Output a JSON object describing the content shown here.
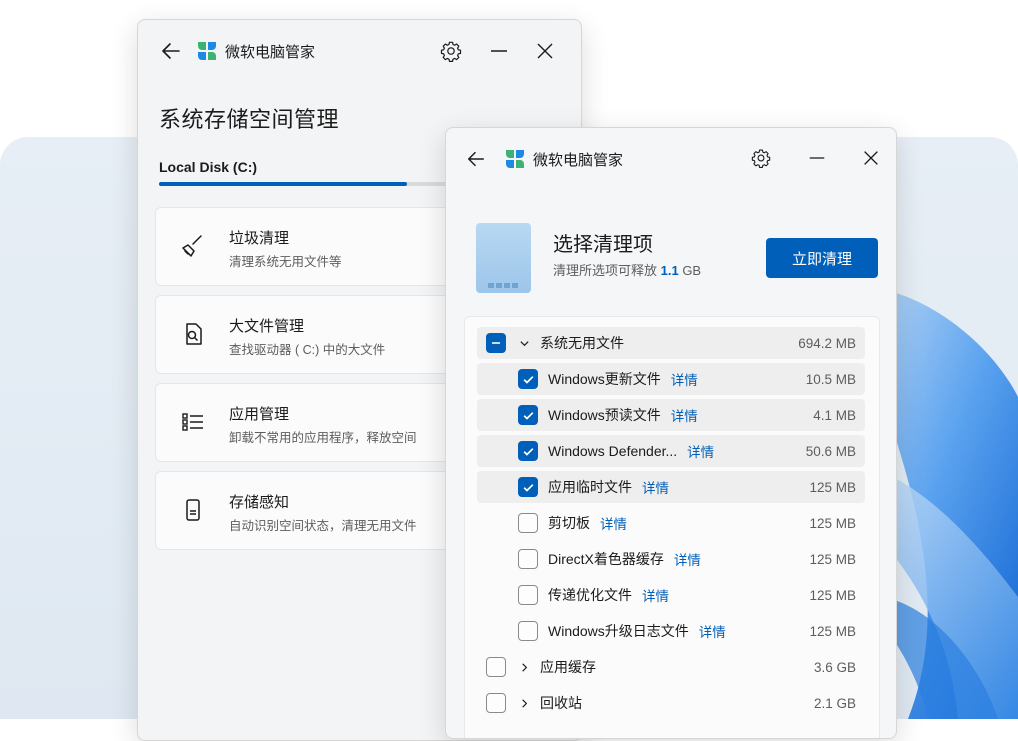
{
  "back_window": {
    "app_title": "微软电脑管家",
    "page_title": "系统存储空间管理",
    "disk_label": "Local Disk (C:)",
    "disk_usage_fraction": 0.62,
    "cards": [
      {
        "title": "垃圾清理",
        "subtitle": "清理系统无用文件等",
        "icon": "broom-icon"
      },
      {
        "title": "大文件管理",
        "subtitle": "查找驱动器 ( C:) 中的大文件",
        "icon": "file-search-icon"
      },
      {
        "title": "应用管理",
        "subtitle": "卸载不常用的应用程序，释放空间",
        "icon": "list-icon"
      },
      {
        "title": "存储感知",
        "subtitle": "自动识别空间状态，清理无用文件",
        "icon": "storage-sense-icon"
      }
    ]
  },
  "front_window": {
    "app_title": "微软电脑管家",
    "heading": "选择清理项",
    "subtitle_prefix": "清理所选项可释放 ",
    "subtitle_amount": "1.1",
    "subtitle_unit": " GB",
    "clean_button": "立即清理",
    "detail_label": "详情",
    "groups": [
      {
        "name": "系统无用文件",
        "size": "694.2 MB",
        "state": "partial",
        "expanded": true
      },
      {
        "name": "应用缓存",
        "size": "3.6 GB",
        "state": "unchecked",
        "expanded": false
      },
      {
        "name": "回收站",
        "size": "2.1 GB",
        "state": "unchecked",
        "expanded": false
      }
    ],
    "items": [
      {
        "name": "Windows更新文件",
        "size": "10.5 MB",
        "checked": true
      },
      {
        "name": "Windows预读文件",
        "size": "4.1 MB",
        "checked": true
      },
      {
        "name": "Windows Defender...",
        "size": "50.6 MB",
        "checked": true
      },
      {
        "name": "应用临时文件",
        "size": "125 MB",
        "checked": true
      },
      {
        "name": "剪切板",
        "size": "125 MB",
        "checked": false
      },
      {
        "name": "DirectX着色器缓存",
        "size": "125 MB",
        "checked": false
      },
      {
        "name": "传递优化文件",
        "size": "125 MB",
        "checked": false
      },
      {
        "name": "Windows升级日志文件",
        "size": "125 MB",
        "checked": false
      }
    ]
  },
  "colors": {
    "accent": "#005fb8",
    "logo_green": "#3cb371",
    "logo_blue": "#1e88e5"
  }
}
